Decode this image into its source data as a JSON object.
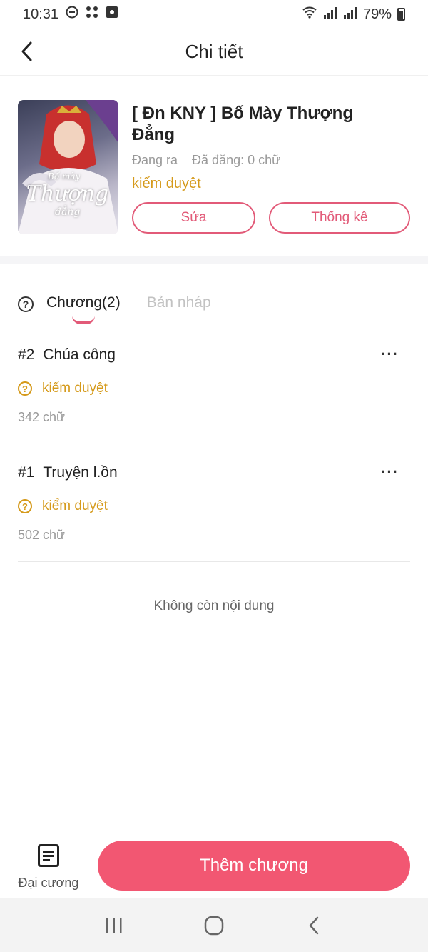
{
  "status_bar": {
    "time": "10:31",
    "battery": "79%"
  },
  "header": {
    "title": "Chi tiết"
  },
  "story": {
    "title": "[ Đn KNY ] Bố Mày Thượng Đẳng",
    "state": "Đang ra",
    "posted": "Đã đăng: 0 chữ",
    "review_status": "kiểm duyệt",
    "edit_label": "Sửa",
    "stats_label": "Thống kê",
    "cover_text": {
      "line1": "Bố mày",
      "line2": "Thượng",
      "line3": "đẳng"
    }
  },
  "tabs": {
    "chapters": "Chương(2)",
    "drafts": "Bản nháp"
  },
  "chapters": [
    {
      "number": "#2",
      "title": "Chúa công",
      "status": "kiểm duyệt",
      "words": "342 chữ"
    },
    {
      "number": "#1",
      "title": "Truyện l.ồn",
      "status": "kiểm duyệt",
      "words": "502 chữ"
    }
  ],
  "end_message": "Không còn nội dung",
  "bottom": {
    "outline_label": "Đại cương",
    "add_chapter_label": "Thêm chương"
  },
  "colors": {
    "accent": "#e25a78",
    "primary_button": "#f25772",
    "review": "#d59a1b"
  }
}
